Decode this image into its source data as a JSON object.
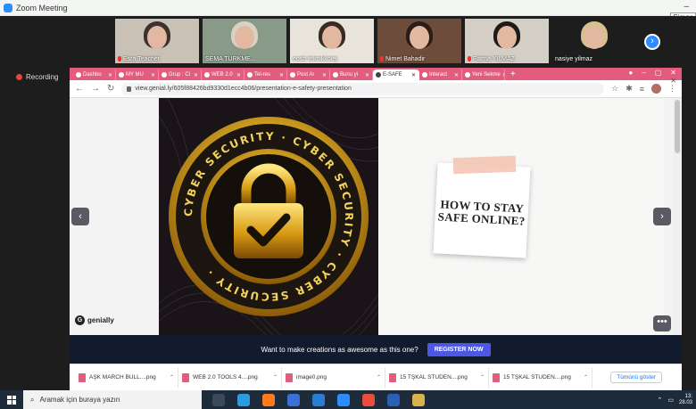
{
  "zoom": {
    "title": "Zoom Meeting",
    "minimize": "–",
    "tooltip": "Simge",
    "recording": "Recording",
    "gallery_next": "›",
    "participants": [
      {
        "name": "Esra Teacher",
        "muted": true,
        "bg": "#c9c1b6",
        "hair": "#3b3230"
      },
      {
        "name": "SEMA TÜRKME...",
        "muted": false,
        "bg": "#8a9a88",
        "hair": "#d9d2c4"
      },
      {
        "name": "eosb teknikkolej",
        "muted": false,
        "bg": "#e8e4dc",
        "hair": "#3a2a24"
      },
      {
        "name": "Nimet Bahadir",
        "muted": true,
        "bg": "#6e4c3c",
        "hair": "#2a1c18"
      },
      {
        "name": "Fatma YILMAZ",
        "muted": true,
        "bg": "#d4cfc6",
        "hair": "#1e1a1a"
      },
      {
        "name": "nasiye yilmaz",
        "muted": false,
        "bg": "#1d1d1d",
        "hair": "#d8c08c"
      }
    ]
  },
  "browser": {
    "tabs": [
      {
        "label": "Dashbo"
      },
      {
        "label": "MY MU"
      },
      {
        "label": "Grup : Ci"
      },
      {
        "label": "WEB 2.0"
      },
      {
        "label": "Tel-res"
      },
      {
        "label": "Post Ar"
      },
      {
        "label": "Bunu yi"
      },
      {
        "label": "E-SAFE",
        "active": true
      },
      {
        "label": "Interact"
      },
      {
        "label": "Yeni Sekme"
      }
    ],
    "new_tab": "+",
    "window_buttons": [
      "●",
      "–",
      "▢",
      "✕"
    ],
    "url": "view.genial.ly/605f88426bd9330d1ecc4b06/presentation-e-safety-presentation",
    "nav": {
      "back": "←",
      "forward": "→",
      "reload": "↻"
    }
  },
  "slide": {
    "ring_text": "CYBER SECURITY · CYBER SECURITY · CYBER SECURITY ·",
    "note_text": "HOW TO STAY SAFE ONLINE?",
    "prev": "‹",
    "next": "›",
    "more": "•••",
    "logo": "genially",
    "logo_letter": "G"
  },
  "promo": {
    "text": "Want to make creations as awesome as this one?",
    "register": "REGISTER NOW"
  },
  "downloads": {
    "items": [
      {
        "name": "AŞK MARCH BULL....png"
      },
      {
        "name": "WEB 2.0 TOOLS 4....png"
      },
      {
        "name": "image0.png"
      },
      {
        "name": "15 TŞKAL STUDEN....png"
      },
      {
        "name": "15 TŞKAL STUDEN....png"
      }
    ],
    "show_all": "Tümünü göster",
    "close": "✕"
  },
  "taskbar": {
    "search_placeholder": "Aramak için buraya yazın",
    "time": "13:",
    "date": "28.03",
    "apps": [
      {
        "name": "task-view",
        "color": "#3a4a5c"
      },
      {
        "name": "edge",
        "color": "#2c9be0"
      },
      {
        "name": "firefox",
        "color": "#ff7a1a"
      },
      {
        "name": "store",
        "color": "#3a6fd8"
      },
      {
        "name": "mail",
        "color": "#2b7cd3"
      },
      {
        "name": "zoom",
        "color": "#2d8cff"
      },
      {
        "name": "chrome",
        "color": "#e84d3d"
      },
      {
        "name": "word",
        "color": "#2b5fb4"
      },
      {
        "name": "paint",
        "color": "#d9b24a"
      }
    ]
  },
  "colors": {
    "tab_strip": "#e45c7d",
    "promo_bg": "#121a2e",
    "register": "#4d57e6",
    "zoom_blue": "#2d8cff"
  }
}
